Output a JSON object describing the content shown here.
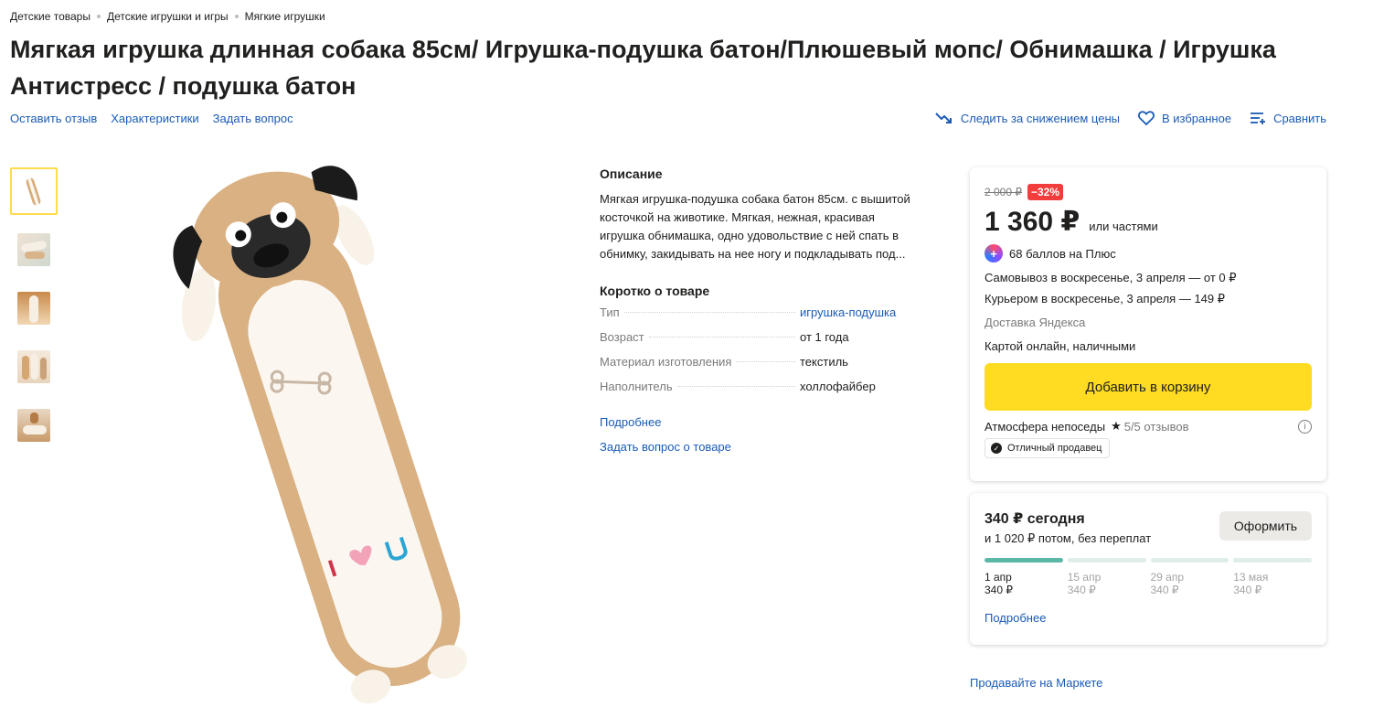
{
  "breadcrumbs": [
    "Детские товары",
    "Детские игрушки и игры",
    "Мягкие игрушки"
  ],
  "title": "Мягкая игрушка длинная собака 85см/ Игрушка-подушка батон/Плюшевый мопс/ Обнимашка / Игрушка Антистресс / подушка батон",
  "subnav": {
    "review": "Оставить отзыв",
    "specs": "Характеристики",
    "question": "Задать вопрос"
  },
  "actions": {
    "price_watch": "Следить за снижением цены",
    "favorites": "В избранное",
    "compare": "Сравнить"
  },
  "description": {
    "heading": "Описание",
    "text": "Мягкая игрушка-подушка собака батон 85см. с вышитой косточкой на животике. Мягкая, нежная, красивая игрушка обнимашка, одно удовольствие с ней спать в обнимку, закидывать на нее ногу и подкладывать под..."
  },
  "summary": {
    "heading": "Коротко о товаре",
    "rows": [
      {
        "name": "Тип",
        "value": "игрушка-подушка"
      },
      {
        "name": "Возраст",
        "value": "от 1 года"
      },
      {
        "name": "Материал изготовления",
        "value": "текстиль"
      },
      {
        "name": "Наполнитель",
        "value": "холлофайбер"
      }
    ],
    "more": "Подробнее",
    "ask": "Задать вопрос о товаре"
  },
  "buy": {
    "old_price": "2 000 ₽",
    "discount": "−32%",
    "price": "1 360 ₽",
    "parts": "или частями",
    "plus_points": "68 баллов на Плюс",
    "pickup": "Самовывоз в воскресенье, 3 апреля — от 0 ₽",
    "courier": "Курьером в воскресенье, 3 апреля — 149 ₽",
    "delivery": "Доставка Яндекса",
    "payment": "Картой онлайн, наличными",
    "cart_button": "Добавить в корзину",
    "seller": "Атмосфера непоседы",
    "rating": "5/5 отзывов",
    "seller_badge": "Отличный продавец"
  },
  "split": {
    "today": "340 ₽ сегодня",
    "later": "и 1 020 ₽ потом, без переплат",
    "button": "Оформить",
    "paid_fraction": 0.25,
    "schedule": [
      {
        "date": "1 апр",
        "amount": "340 ₽"
      },
      {
        "date": "15 апр",
        "amount": "340 ₽"
      },
      {
        "date": "29 апр",
        "amount": "340 ₽"
      },
      {
        "date": "13 мая",
        "amount": "340 ₽"
      }
    ],
    "more": "Подробнее"
  },
  "sell_link": "Продавайте на Маркете",
  "colors": {
    "link": "#1a5bb5",
    "cart": "#ffdb22",
    "discount": "#f33d3d",
    "progress": "#5bb8a6"
  }
}
